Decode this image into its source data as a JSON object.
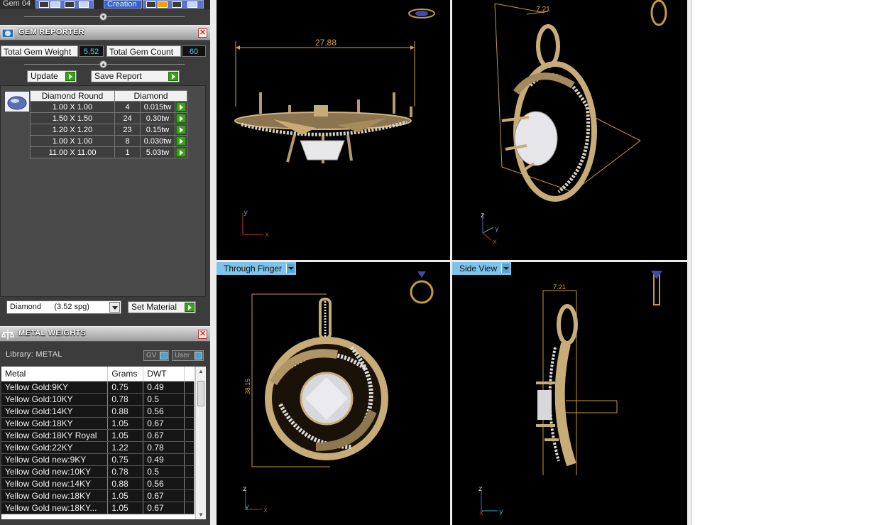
{
  "top_tabs": {
    "gem_tab": "Gem 04",
    "creation_tab": "Creation"
  },
  "gem_reporter": {
    "title": "GEM REPORTER",
    "total_weight_label": "Total Gem Weight",
    "total_weight_value": "5.52",
    "total_count_label": "Total Gem Count",
    "total_count_value": "60",
    "update_label": "Update",
    "save_report_label": "Save Report",
    "table": {
      "header_shape": "Diamond Round",
      "header_material": "Diamond",
      "rows": [
        {
          "size": "1.00 X 1.00",
          "count": "4",
          "weight": "0.015tw"
        },
        {
          "size": "1.50 X 1.50",
          "count": "24",
          "weight": "0.30tw"
        },
        {
          "size": "1.20 X 1.20",
          "count": "23",
          "weight": "0.15tw"
        },
        {
          "size": "1.00 X 1.00",
          "count": "8",
          "weight": "0.030tw"
        },
        {
          "size": "11.00 X 11.00",
          "count": "1",
          "weight": "5.03tw"
        }
      ]
    },
    "material_select": "Diamond      (3.52 spg)",
    "set_material_label": "Set Material"
  },
  "metal_weights": {
    "title": "METAL WEIGHTS",
    "library_label": "Library: METAL",
    "toggle_gv": "GV",
    "toggle_user": "User",
    "columns": [
      "Metal",
      "Grams",
      "DWT"
    ],
    "rows": [
      {
        "metal": "Yellow Gold:9KY",
        "grams": "0.75",
        "dwt": "0.49"
      },
      {
        "metal": "Yellow Gold:10KY",
        "grams": "0.78",
        "dwt": "0.5"
      },
      {
        "metal": "Yellow Gold:14KY",
        "grams": "0.88",
        "dwt": "0.56"
      },
      {
        "metal": "Yellow Gold:18KY",
        "grams": "1.05",
        "dwt": "0.67"
      },
      {
        "metal": "Yellow Gold:18KY Royal",
        "grams": "1.05",
        "dwt": "0.67"
      },
      {
        "metal": "Yellow Gold:22KY",
        "grams": "1.22",
        "dwt": "0.78"
      },
      {
        "metal": "Yellow Gold new:9KY",
        "grams": "0.75",
        "dwt": "0.49"
      },
      {
        "metal": "Yellow Gold new:10KY",
        "grams": "0.78",
        "dwt": "0.5"
      },
      {
        "metal": "Yellow Gold new:14KY",
        "grams": "0.88",
        "dwt": "0.56"
      },
      {
        "metal": "Yellow Gold new:18KY",
        "grams": "1.05",
        "dwt": "0.67"
      },
      {
        "metal": "Yellow Gold new:18KY...",
        "grams": "1.05",
        "dwt": "0.67"
      }
    ]
  },
  "viewports": {
    "top_left_dimension": "27.88",
    "top_right_dimension": "7.21",
    "bottom_left_label": "Through Finger",
    "bottom_left_dimension": "38.15",
    "bottom_right_label": "Side View",
    "bottom_right_dimension": "7.21",
    "axis_x": "x",
    "axis_y": "y",
    "axis_z": "z"
  }
}
